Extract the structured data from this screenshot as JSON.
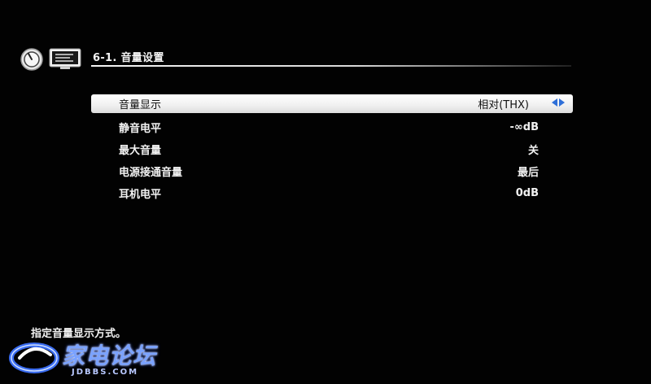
{
  "header": {
    "icons": [
      "volume-knob-icon",
      "display-monitor-icon"
    ],
    "title": "6-1. 音量设置"
  },
  "menu": {
    "items": [
      {
        "label": "音量显示",
        "value": "相对(THX)",
        "selected": true
      },
      {
        "label": "静音电平",
        "value": "-∞dB",
        "selected": false
      },
      {
        "label": "最大音量",
        "value": "关",
        "selected": false
      },
      {
        "label": "电源接通音量",
        "value": "最后",
        "selected": false
      },
      {
        "label": "耳机电平",
        "value": "0dB",
        "selected": false
      }
    ]
  },
  "help": {
    "text": "指定音量显示方式。"
  },
  "watermark": {
    "title": "家电论坛",
    "subtitle": "JDBBS.COM"
  },
  "colors": {
    "background": "#020202",
    "selected_bg": "#ffffff",
    "accent_arrow": "#2e6fd8",
    "text": "#f2f2f2"
  }
}
